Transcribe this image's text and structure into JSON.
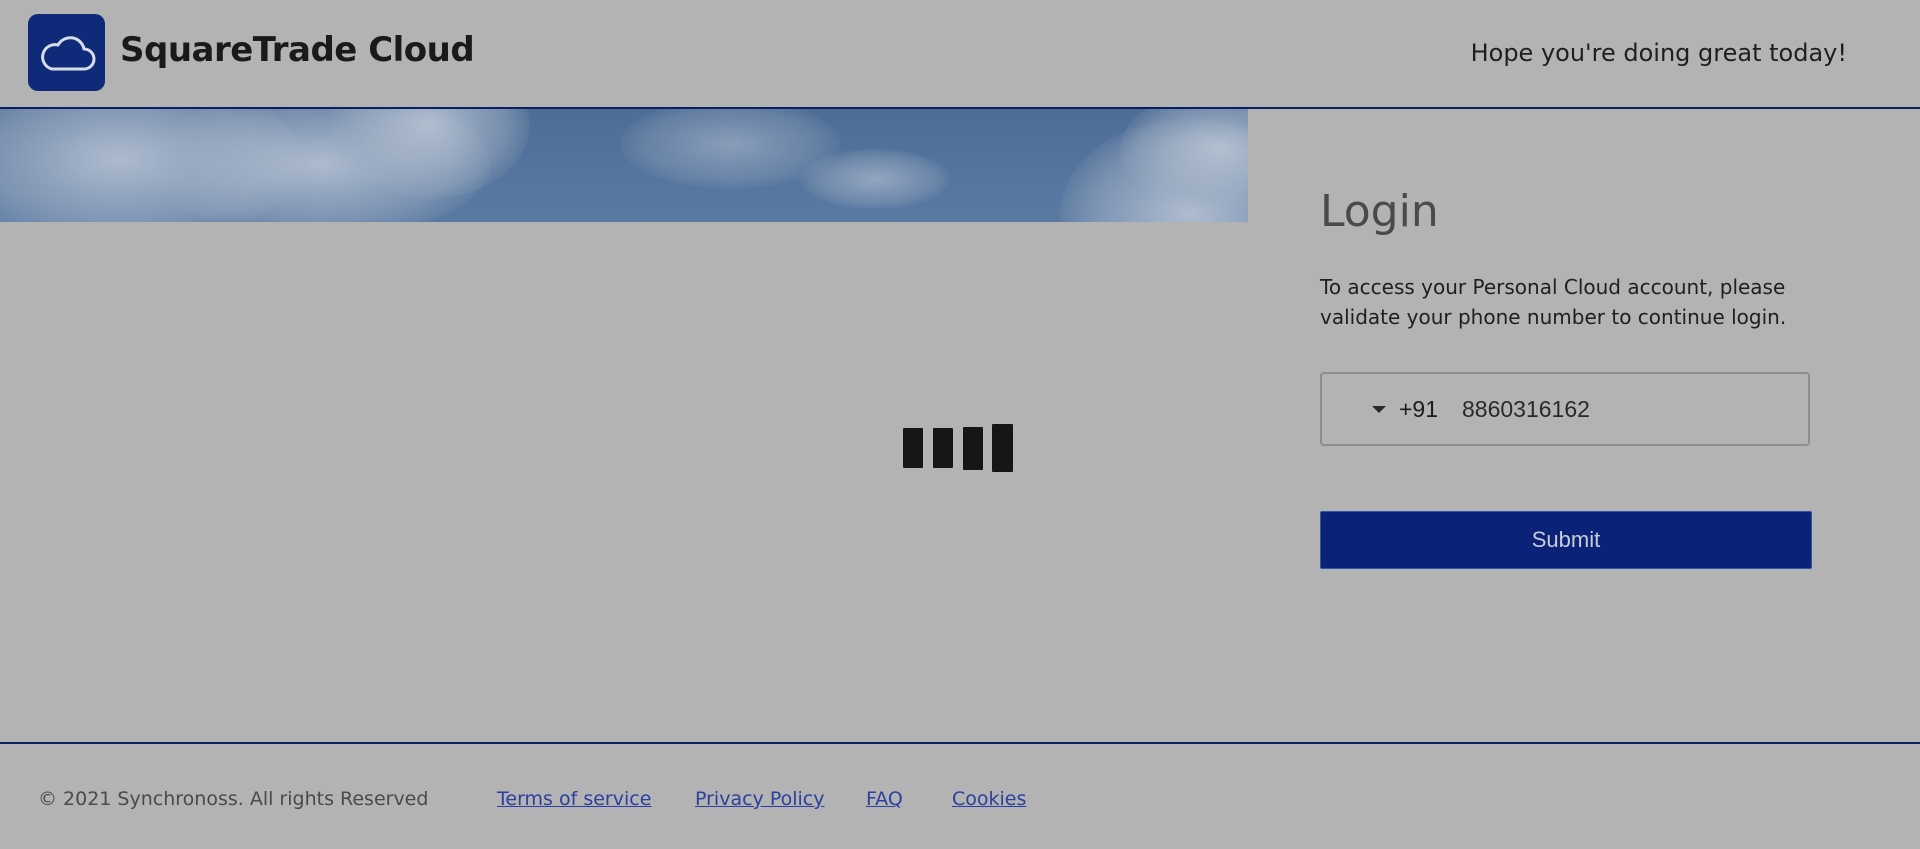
{
  "header": {
    "brand": "SquareTrade Cloud",
    "logo_icon": "cloud-icon",
    "greeting": "Hope you're doing great today!"
  },
  "loader": {
    "icon": "loading-bars-icon"
  },
  "login": {
    "title": "Login",
    "description": "To access your Personal Cloud account, please validate your phone number to continue login.",
    "dial_code": "+91",
    "phone_value": "8860316162",
    "submit_label": "Submit"
  },
  "footer": {
    "copyright": "©  2021  Synchronoss. All rights Reserved",
    "links": [
      "Terms of service",
      "Privacy Policy",
      "FAQ",
      "Cookies"
    ]
  },
  "colors": {
    "brand_navy": "#0a2277",
    "overlay_gray": "#b3b3b3",
    "link": "#2a3fa0"
  }
}
